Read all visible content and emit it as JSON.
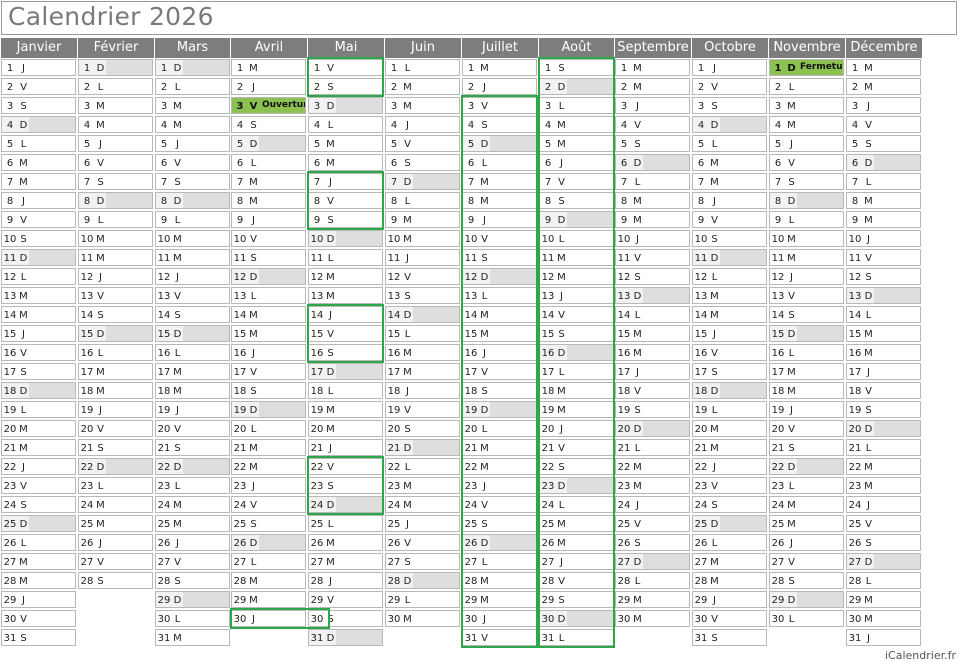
{
  "title": "Calendrier 2026",
  "footer": "iCalendrier.fr",
  "months": [
    {
      "name": "Janvier",
      "days": 31,
      "first_weekday": 4
    },
    {
      "name": "Février",
      "days": 28,
      "first_weekday": 0
    },
    {
      "name": "Mars",
      "days": 31,
      "first_weekday": 0
    },
    {
      "name": "Avril",
      "days": 30,
      "first_weekday": 3
    },
    {
      "name": "Mai",
      "days": 31,
      "first_weekday": 5
    },
    {
      "name": "Juin",
      "days": 30,
      "first_weekday": 1
    },
    {
      "name": "Juillet",
      "days": 31,
      "first_weekday": 3
    },
    {
      "name": "Août",
      "days": 31,
      "first_weekday": 6
    },
    {
      "name": "Septembre",
      "days": 30,
      "first_weekday": 2
    },
    {
      "name": "Octobre",
      "days": 31,
      "first_weekday": 4
    },
    {
      "name": "Novembre",
      "days": 30,
      "first_weekday": 0
    },
    {
      "name": "Décembre",
      "days": 31,
      "first_weekday": 2
    }
  ],
  "weekday_letters": [
    "D",
    "L",
    "M",
    "M",
    "J",
    "V",
    "S"
  ],
  "events": [
    {
      "month": 3,
      "day": 3,
      "label": "Ouverture"
    },
    {
      "month": 10,
      "day": 1,
      "label": "Fermeture"
    }
  ],
  "highlighted_ranges": [
    {
      "month": 3,
      "from": 30,
      "to": 30
    },
    {
      "month": 4,
      "from": 1,
      "to": 2
    },
    {
      "month": 4,
      "from": 7,
      "to": 9
    },
    {
      "month": 4,
      "from": 14,
      "to": 16
    },
    {
      "month": 4,
      "from": 22,
      "to": 24
    },
    {
      "month": 6,
      "from": 3,
      "to": 31
    },
    {
      "month": 7,
      "from": 1,
      "to": 31
    }
  ],
  "colors": {
    "header_bg": "#7d7d7d",
    "sunday_bg": "#dedede",
    "event_bg": "#8cc152",
    "highlight_border": "#2aa84a"
  }
}
